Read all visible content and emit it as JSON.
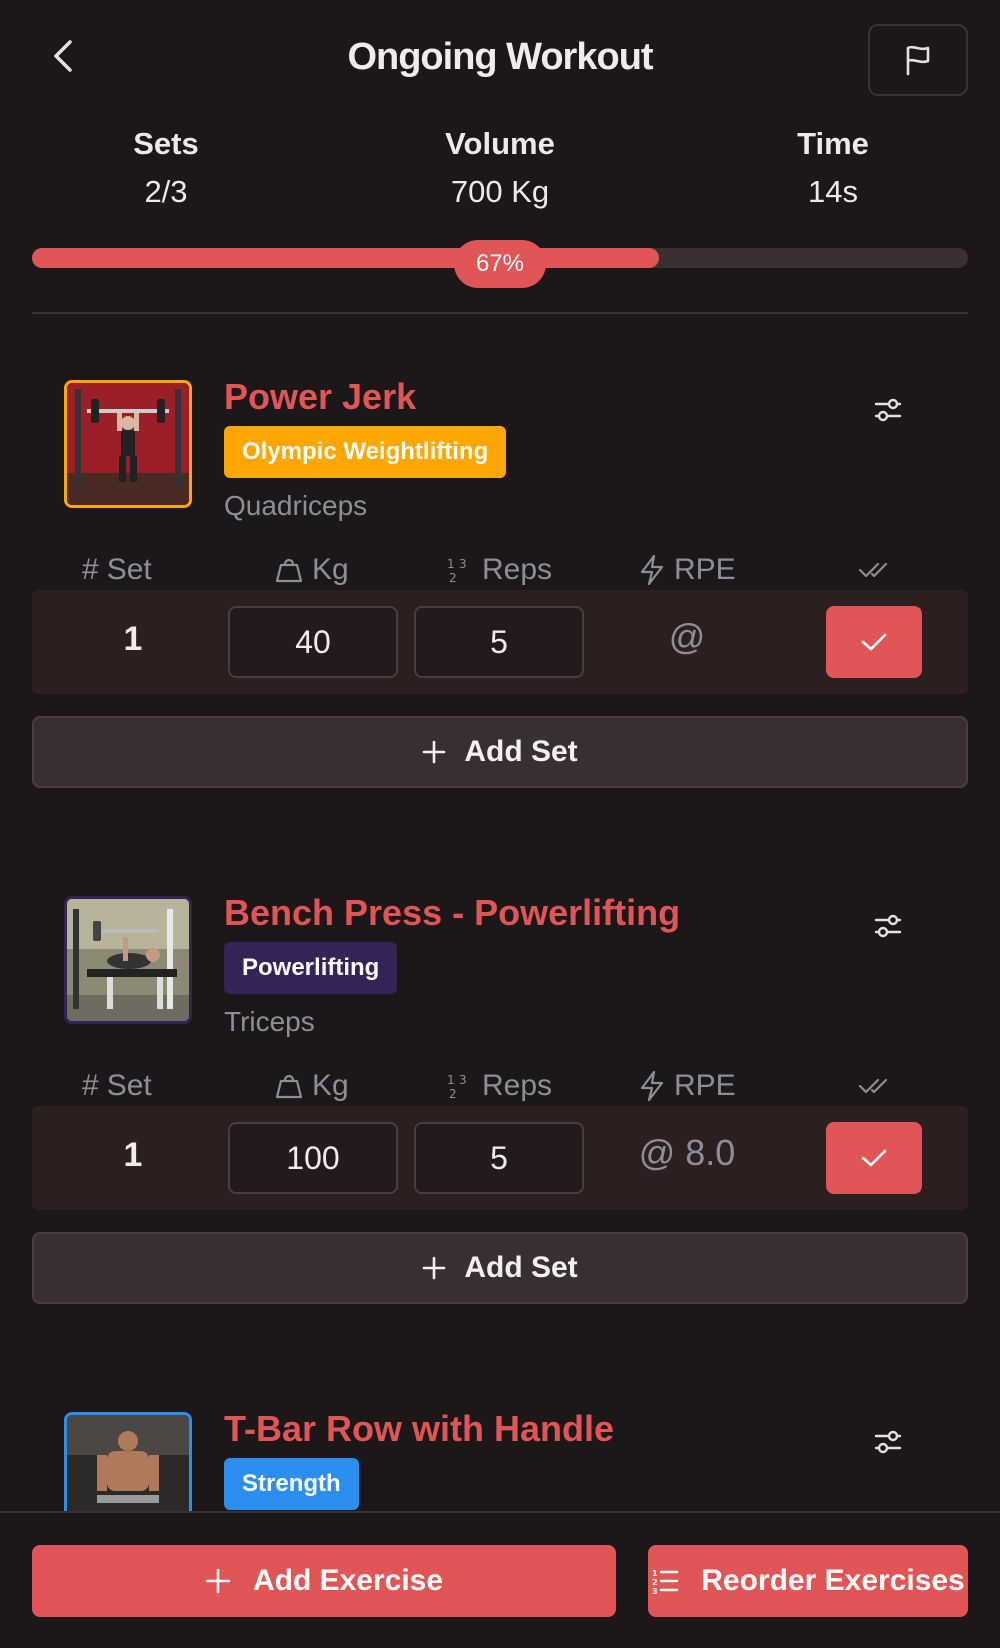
{
  "header": {
    "title": "Ongoing Workout",
    "back_icon": "chevron-left-icon",
    "flag_icon": "flag-icon"
  },
  "stats": {
    "sets_label": "Sets",
    "sets_value": "2/3",
    "volume_label": "Volume",
    "volume_value": "700 Kg",
    "time_label": "Time",
    "time_value": "14s"
  },
  "progress": {
    "percent": 67,
    "label": "67%"
  },
  "columns": {
    "set": "Set",
    "kg": "Kg",
    "reps": "Reps",
    "rpe": "RPE"
  },
  "colors": {
    "accent": "#e15557",
    "background": "#1c1718",
    "tag_olympic": "#ffa600",
    "tag_powerlifting": "#332357",
    "tag_strength": "#2b8ff0"
  },
  "exercises": [
    {
      "name": "Power Jerk",
      "tag": "Olympic Weightlifting",
      "tag_color": "#ffa600",
      "muscle": "Quadriceps",
      "sets": [
        {
          "num": "1",
          "kg": "40",
          "reps": "5",
          "rpe": "@"
        }
      ],
      "add_set_label": "Add Set"
    },
    {
      "name": "Bench Press - Powerlifting",
      "tag": "Powerlifting",
      "tag_color": "#332357",
      "muscle": "Triceps",
      "sets": [
        {
          "num": "1",
          "kg": "100",
          "reps": "5",
          "rpe": "@ 8.0"
        }
      ],
      "add_set_label": "Add Set"
    },
    {
      "name": "T-Bar Row with Handle",
      "tag": "Strength",
      "tag_color": "#2b8ff0"
    }
  ],
  "bottom": {
    "add_exercise_label": "Add Exercise",
    "reorder_label": "Reorder Exercises"
  }
}
